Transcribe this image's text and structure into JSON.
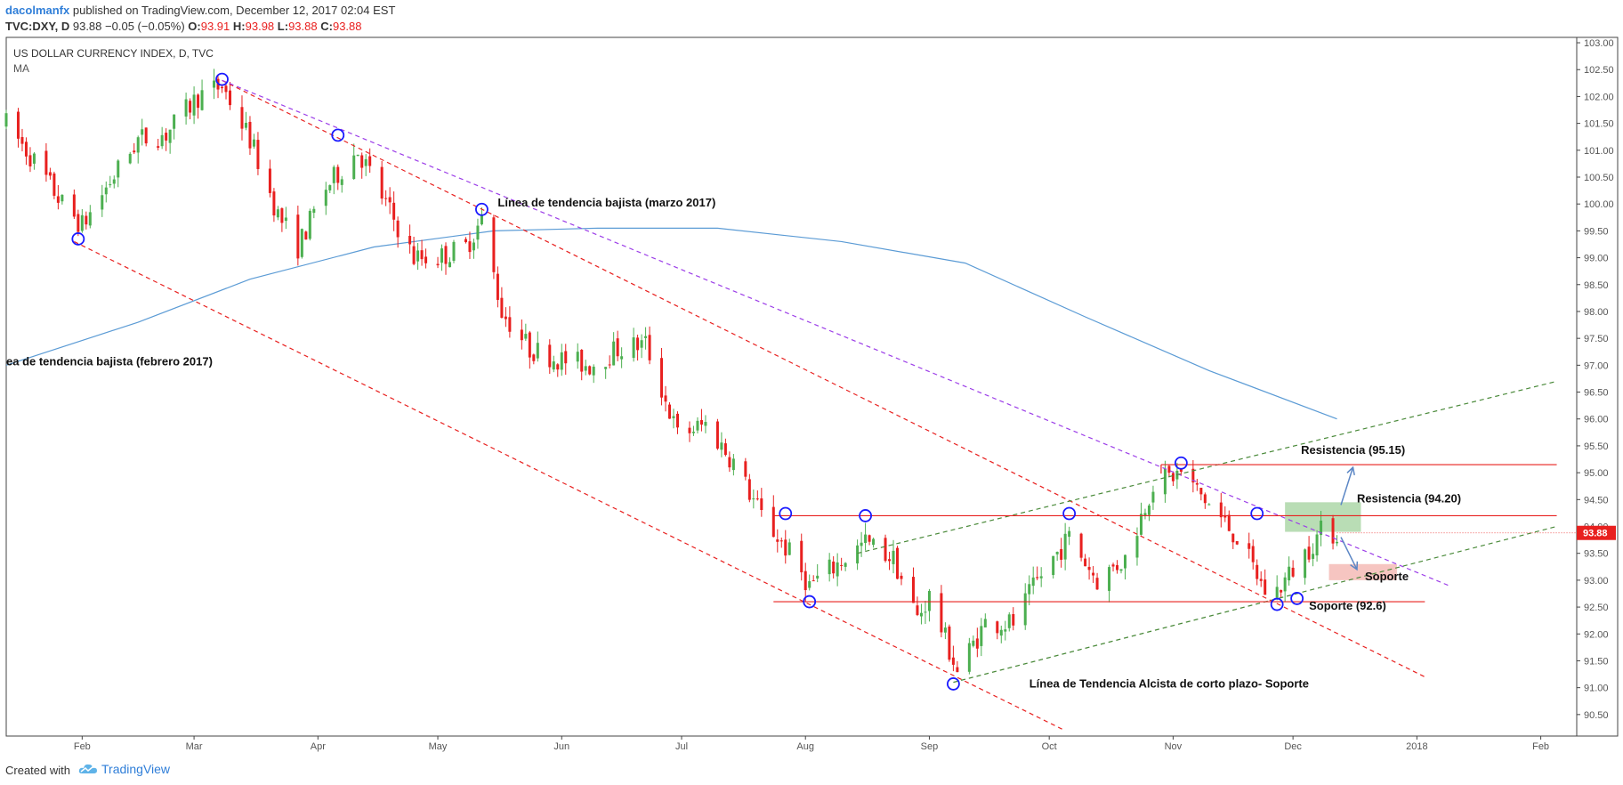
{
  "header": {
    "author": "dacolmanfx",
    "published": " published on TradingView.com, December 12, 2017 02:04 EST",
    "symbol": "TVC:DXY, D",
    "last": "93.88",
    "change": "−0.05 (−0.05%)",
    "o_label": "O:",
    "o_value": "93.91",
    "h_label": "H:",
    "h_value": "93.98",
    "l_label": "L:",
    "l_value": "93.88",
    "c_label": "C:",
    "c_value": "93.88"
  },
  "footer": {
    "created": "Created with",
    "brand": "TradingView"
  },
  "colors": {
    "bull": "#4caf50",
    "bear": "#e8201f",
    "ma": "#5b9bd5",
    "resistance_zone": "#a8d5a2",
    "support_zone": "#f4b6b2"
  },
  "chart_data": {
    "type": "candlestick",
    "title": "US DOLLAR CURRENCY INDEX, D, TVC",
    "indicator": "MA",
    "y_range": [
      90.1,
      103.1
    ],
    "y_ticks": [
      "103.00",
      "102.50",
      "102.00",
      "101.50",
      "101.00",
      "100.50",
      "100.00",
      "99.50",
      "99.00",
      "98.50",
      "98.00",
      "97.50",
      "97.00",
      "96.50",
      "96.00",
      "95.50",
      "95.00",
      "94.50",
      "94.00",
      "93.50",
      "93.00",
      "92.50",
      "92.00",
      "91.50",
      "91.00",
      "90.50"
    ],
    "x_range": [
      "2017-01-13",
      "2018-02-10"
    ],
    "x_ticks": [
      {
        "date": "2017-02-01",
        "label": "Feb"
      },
      {
        "date": "2017-03-01",
        "label": "Mar"
      },
      {
        "date": "2017-04-01",
        "label": "Apr"
      },
      {
        "date": "2017-05-01",
        "label": "May"
      },
      {
        "date": "2017-06-01",
        "label": "Jun"
      },
      {
        "date": "2017-07-01",
        "label": "Jul"
      },
      {
        "date": "2017-08-01",
        "label": "Aug"
      },
      {
        "date": "2017-09-01",
        "label": "Sep"
      },
      {
        "date": "2017-10-01",
        "label": "Oct"
      },
      {
        "date": "2017-11-01",
        "label": "Nov"
      },
      {
        "date": "2017-12-01",
        "label": "Dec"
      },
      {
        "date": "2018-01-01",
        "label": "2018"
      },
      {
        "date": "2018-02-01",
        "label": "Feb"
      }
    ],
    "last_price": "93.88",
    "price_path": [
      [
        "2017-01-13",
        101.5
      ],
      [
        "2017-01-20",
        100.8
      ],
      [
        "2017-01-27",
        100.0
      ],
      [
        "2017-02-01",
        99.6
      ],
      [
        "2017-02-07",
        100.3
      ],
      [
        "2017-02-15",
        101.2
      ],
      [
        "2017-02-22",
        101.3
      ],
      [
        "2017-03-02",
        102.0
      ],
      [
        "2017-03-08",
        102.2
      ],
      [
        "2017-03-15",
        101.2
      ],
      [
        "2017-03-22",
        99.8
      ],
      [
        "2017-03-27",
        99.2
      ],
      [
        "2017-04-03",
        100.3
      ],
      [
        "2017-04-11",
        101.0
      ],
      [
        "2017-04-18",
        100.0
      ],
      [
        "2017-04-25",
        99.0
      ],
      [
        "2017-05-01",
        99.0
      ],
      [
        "2017-05-08",
        99.2
      ],
      [
        "2017-05-12",
        99.7
      ],
      [
        "2017-05-17",
        98.0
      ],
      [
        "2017-05-24",
        97.3
      ],
      [
        "2017-06-01",
        97.1
      ],
      [
        "2017-06-08",
        97.0
      ],
      [
        "2017-06-15",
        97.3
      ],
      [
        "2017-06-22",
        97.4
      ],
      [
        "2017-06-30",
        95.7
      ],
      [
        "2017-07-07",
        95.9
      ],
      [
        "2017-07-14",
        95.2
      ],
      [
        "2017-07-21",
        94.2
      ],
      [
        "2017-07-28",
        93.5
      ],
      [
        "2017-08-02",
        92.9
      ],
      [
        "2017-08-09",
        93.3
      ],
      [
        "2017-08-16",
        93.7
      ],
      [
        "2017-08-23",
        93.4
      ],
      [
        "2017-08-29",
        92.3
      ],
      [
        "2017-09-01",
        92.7
      ],
      [
        "2017-09-08",
        91.3
      ],
      [
        "2017-09-15",
        92.2
      ],
      [
        "2017-09-22",
        92.2
      ],
      [
        "2017-09-29",
        93.1
      ],
      [
        "2017-10-06",
        93.8
      ],
      [
        "2017-10-13",
        93.0
      ],
      [
        "2017-10-20",
        93.4
      ],
      [
        "2017-10-27",
        94.8
      ],
      [
        "2017-11-03",
        95.0
      ],
      [
        "2017-11-10",
        94.4
      ],
      [
        "2017-11-17",
        93.8
      ],
      [
        "2017-11-24",
        92.8
      ],
      [
        "2017-11-27",
        92.8
      ],
      [
        "2017-12-01",
        93.2
      ],
      [
        "2017-12-08",
        93.9
      ],
      [
        "2017-12-12",
        93.88
      ]
    ],
    "moving_average": [
      [
        "2017-01-13",
        97.0
      ],
      [
        "2017-02-15",
        97.8
      ],
      [
        "2017-03-15",
        98.6
      ],
      [
        "2017-04-15",
        99.2
      ],
      [
        "2017-05-15",
        99.5
      ],
      [
        "2017-06-10",
        99.55
      ],
      [
        "2017-07-10",
        99.55
      ],
      [
        "2017-08-10",
        99.3
      ],
      [
        "2017-09-10",
        98.9
      ],
      [
        "2017-10-10",
        97.9
      ],
      [
        "2017-11-10",
        96.9
      ],
      [
        "2017-12-12",
        96.0
      ]
    ],
    "trendlines": [
      {
        "style": "dashed",
        "color": "#e8201f",
        "from": [
          "2017-01-30",
          99.3
        ],
        "to": [
          "2017-10-05",
          90.2
        ]
      },
      {
        "style": "dashed",
        "color": "#e8201f",
        "from": [
          "2017-03-08",
          102.3
        ],
        "to": [
          "2018-01-03",
          91.2
        ]
      },
      {
        "style": "dashed",
        "color": "#9c3ee8",
        "from": [
          "2017-03-08",
          102.3
        ],
        "to": [
          "2018-01-09",
          92.9
        ]
      },
      {
        "style": "dashed",
        "color": "#4a8a3a",
        "from": [
          "2017-08-14",
          93.5
        ],
        "to": [
          "2018-02-05",
          96.7
        ]
      },
      {
        "style": "dashed",
        "color": "#4a8a3a",
        "from": [
          "2017-09-07",
          91.1
        ],
        "to": [
          "2018-02-05",
          94.0
        ]
      }
    ],
    "levels": [
      {
        "price": 95.15,
        "from": "2017-10-29",
        "to": "2018-02-05",
        "label": "Resistencia (95.15)"
      },
      {
        "price": 94.2,
        "from": "2017-07-24",
        "to": "2018-02-05",
        "label": "Resistencia (94.20)"
      },
      {
        "price": 92.6,
        "from": "2017-07-24",
        "to": "2018-01-03",
        "label": "Soporte (92.6)"
      }
    ],
    "annotations": [
      {
        "text": "Línea de tendencia bajista (marzo 2017)",
        "at": [
          "2017-05-16",
          99.95
        ]
      },
      {
        "text": "ea de tendencia bajista (febrero 2017)",
        "at": [
          "2017-01-13",
          97.0
        ]
      },
      {
        "text": "Línea de Tendencia Alcista de corto plazo- Soporte",
        "at": [
          "2017-09-26",
          91.0
        ]
      },
      {
        "text": "Resistencia (95.15)",
        "at": [
          "2017-12-03",
          95.35
        ]
      },
      {
        "text": "Resistencia (94.20)",
        "at": [
          "2017-12-17",
          94.45
        ]
      },
      {
        "text": "Soporte",
        "at": [
          "2017-12-19",
          93.0
        ]
      },
      {
        "text": "Soporte (92.6)",
        "at": [
          "2017-12-05",
          92.45
        ]
      }
    ],
    "zones": [
      {
        "type": "resistance",
        "from": "2017-11-29",
        "to": "2017-12-18",
        "y": [
          93.9,
          94.45
        ]
      },
      {
        "type": "support",
        "from": "2017-12-10",
        "to": "2017-12-27",
        "y": [
          93.0,
          93.3
        ]
      }
    ],
    "markers": [
      [
        "2017-01-31",
        99.35
      ],
      [
        "2017-03-08",
        102.32
      ],
      [
        "2017-04-06",
        101.28
      ],
      [
        "2017-05-12",
        99.9
      ],
      [
        "2017-07-27",
        94.24
      ],
      [
        "2017-08-02",
        92.6
      ],
      [
        "2017-08-16",
        94.2
      ],
      [
        "2017-09-07",
        91.07
      ],
      [
        "2017-10-06",
        94.24
      ],
      [
        "2017-11-03",
        95.18
      ],
      [
        "2017-11-22",
        94.24
      ],
      [
        "2017-11-27",
        92.55
      ],
      [
        "2017-12-02",
        92.66
      ]
    ],
    "arrows": [
      {
        "from": [
          "2017-12-13",
          94.4
        ],
        "to": [
          "2017-12-16",
          95.1
        ]
      },
      {
        "from": [
          "2017-12-13",
          93.8
        ],
        "to": [
          "2017-12-17",
          93.2
        ]
      }
    ]
  }
}
